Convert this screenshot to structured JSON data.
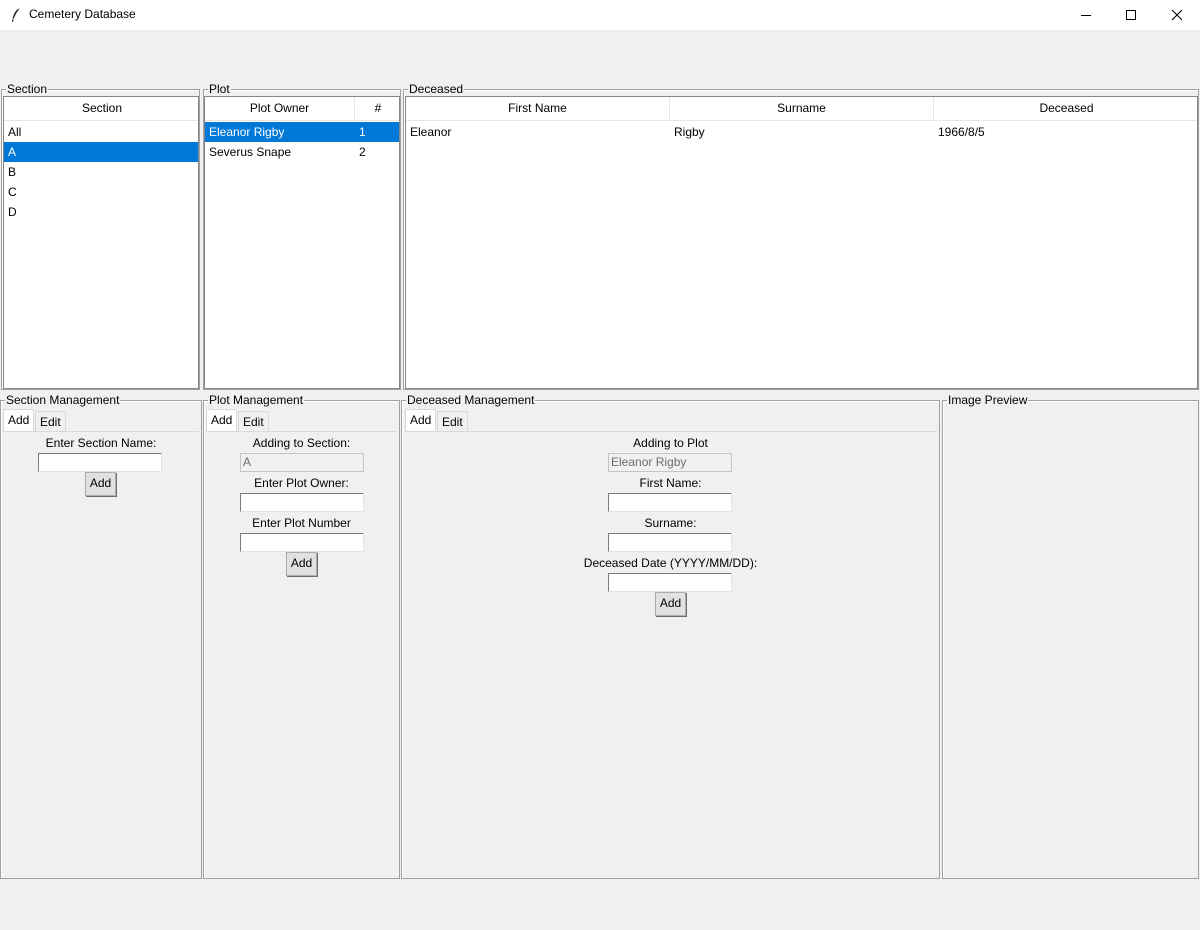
{
  "window": {
    "title": "Cemetery Database",
    "icon": "feather-icon",
    "controls": [
      "minimize-icon",
      "maximize-icon",
      "close-icon"
    ]
  },
  "section_frame": {
    "label": "Section",
    "header": "Section",
    "items": [
      "All",
      "A",
      "B",
      "C",
      "D"
    ],
    "selected": "A"
  },
  "plot_frame": {
    "label": "Plot",
    "headers": [
      "Plot Owner",
      "#"
    ],
    "rows": [
      {
        "owner": "Eleanor Rigby",
        "number": "1"
      },
      {
        "owner": "Severus Snape",
        "number": "2"
      }
    ],
    "selected": "Eleanor Rigby"
  },
  "deceased_frame": {
    "label": "Deceased",
    "headers": [
      "First Name",
      "Surname",
      "Deceased"
    ],
    "rows": [
      {
        "first": "Eleanor",
        "surname": "Rigby",
        "date": "1966/8/5"
      }
    ]
  },
  "section_mgmt": {
    "label": "Section Management",
    "tabs": [
      "Add",
      "Edit"
    ],
    "name_label": "Enter Section Name:",
    "name_value": "",
    "add_button": "Add"
  },
  "plot_mgmt": {
    "label": "Plot Management",
    "tabs": [
      "Add",
      "Edit"
    ],
    "section_label": "Adding to Section:",
    "section_value": "A",
    "owner_label": "Enter Plot Owner:",
    "owner_value": "",
    "number_label": "Enter Plot Number",
    "number_value": "",
    "add_button": "Add"
  },
  "deceased_mgmt": {
    "label": "Deceased Management",
    "tabs": [
      "Add",
      "Edit"
    ],
    "plot_label": "Adding to Plot",
    "plot_value": "Eleanor Rigby",
    "first_label": "First Name:",
    "first_value": "",
    "surname_label": "Surname:",
    "surname_value": "",
    "date_label": "Deceased Date (YYYY/MM/DD):",
    "date_value": "",
    "add_button": "Add"
  },
  "image_preview": {
    "label": "Image Preview"
  },
  "colors": {
    "selection": "#0078d7",
    "background": "#f0f0f0"
  }
}
